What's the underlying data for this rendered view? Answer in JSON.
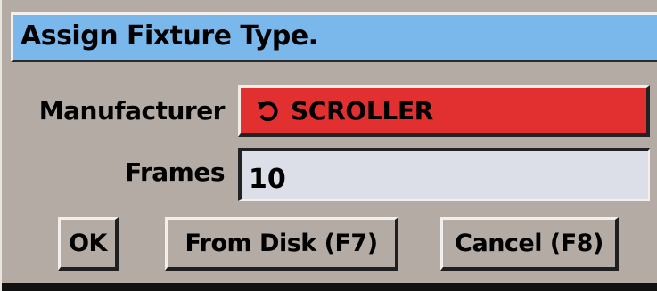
{
  "dialog": {
    "title": "Assign Fixture Type."
  },
  "fields": {
    "manufacturer_label": "Manufacturer",
    "manufacturer_value": "SCROLLER",
    "frames_label": "Frames",
    "frames_value": "10"
  },
  "buttons": {
    "ok": "OK",
    "from_disk": "From Disk (F7)",
    "cancel": "Cancel (F8)"
  },
  "colors": {
    "title_bar": "#7ab7ea",
    "manufacturer_button": "#e23030",
    "frames_field": "#dcdee8",
    "dialog_background": "#b3aba4"
  },
  "icons": {
    "manufacturer_cycle": "cycle-arrow-icon"
  }
}
